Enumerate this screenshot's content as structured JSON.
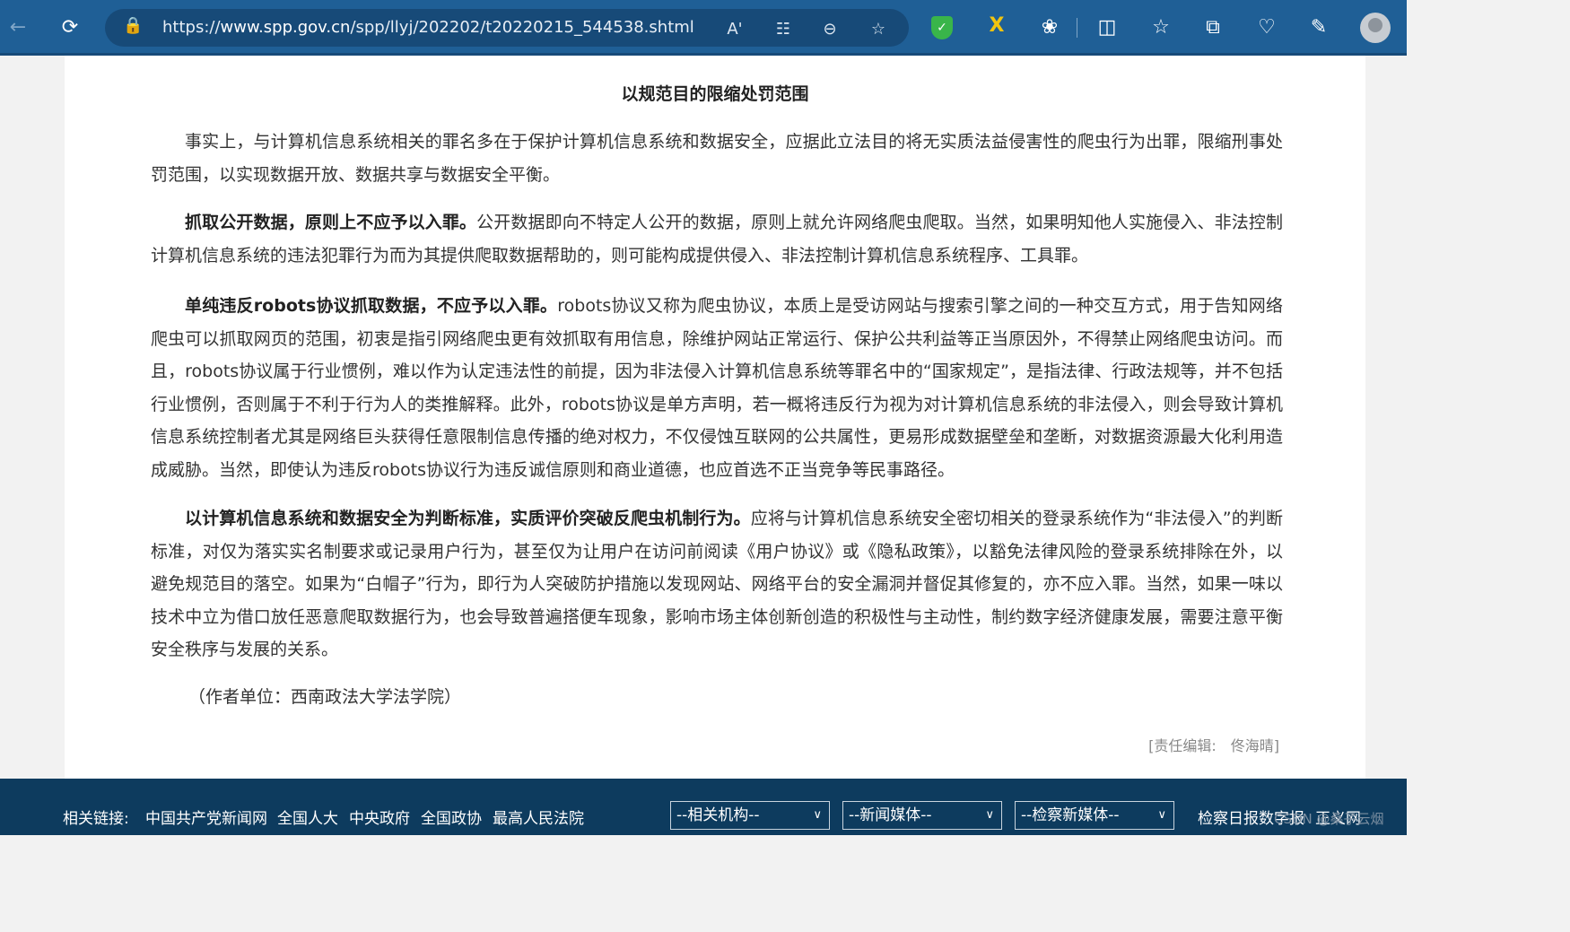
{
  "browser": {
    "url_prefix": "https://",
    "url_domain": "www.spp.gov.cn",
    "url_path": "/spp/llyj/202202/t20220215_544538.shtml"
  },
  "article": {
    "title": "以规范目的限缩处罚范围",
    "p1": "事实上，与计算机信息系统相关的罪名多在于保护计算机信息系统和数据安全，应据此立法目的将无实质法益侵害性的爬虫行为出罪，限缩刑事处罚范围，以实现数据开放、数据共享与数据安全平衡。",
    "p2_bold": "抓取公开数据，原则上不应予以入罪。",
    "p2_text": "公开数据即向不特定人公开的数据，原则上就允许网络爬虫爬取。当然，如果明知他人实施侵入、非法控制计算机信息系统的违法犯罪行为而为其提供爬取数据帮助的，则可能构成提供侵入、非法控制计算机信息系统程序、工具罪。",
    "p3_bold": "单纯违反robots协议抓取数据，不应予以入罪。",
    "p3_text": "robots协议又称为爬虫协议，本质上是受访网站与搜索引擎之间的一种交互方式，用于告知网络爬虫可以抓取网页的范围，初衷是指引网络爬虫更有效抓取有用信息，除维护网站正常运行、保护公共利益等正当原因外，不得禁止网络爬虫访问。而且，robots协议属于行业惯例，难以作为认定违法性的前提，因为非法侵入计算机信息系统等罪名中的“国家规定”，是指法律、行政法规等，并不包括行业惯例，否则属于不利于行为人的类推解释。此外，robots协议是单方声明，若一概将违反行为视为对计算机信息系统的非法侵入，则会导致计算机信息系统控制者尤其是网络巨头获得任意限制信息传播的绝对权力，不仅侵蚀互联网的公共属性，更易形成数据壁垒和垄断，对数据资源最大化利用造成威胁。当然，即使认为违反robots协议行为违反诚信原则和商业道德，也应首选不正当竞争等民事路径。",
    "p4_bold": "以计算机信息系统和数据安全为判断标准，实质评价突破反爬虫机制行为。",
    "p4_text": "应将与计算机信息系统安全密切相关的登录系统作为“非法侵入”的判断标准，对仅为落实实名制要求或记录用户行为，甚至仅为让用户在访问前阅读《用户协议》或《隐私政策》，以豁免法律风险的登录系统排除在外，以避免规范目的落空。如果为“白帽子”行为，即行为人突破防护措施以发现网站、网络平台的安全漏洞并督促其修复的，亦不应入罪。当然，如果一味以技术中立为借口放任恶意爬取数据行为，也会导致普遍搭便车现象，影响市场主体创新创造的积极性与主动性，制约数字经济健康发展，需要注意平衡安全秩序与发展的关系。",
    "author": "（作者单位：西南政法大学法学院）",
    "editor": "[责任编辑:　佟海晴]"
  },
  "footer": {
    "label": "相关链接:",
    "links": [
      "中国共产党新闻网",
      "全国人大",
      "中央政府",
      "全国政协",
      "最高人民法院"
    ],
    "selects": [
      "--相关机构--",
      "--新闻媒体--",
      "--检察新媒体--"
    ],
    "right_links": [
      "检察日报数字报",
      "正义网"
    ],
    "watermark": "CSDN @桑子云烟"
  },
  "colors": {
    "toolbar": "#1f5f96",
    "footer": "#0d3b5e",
    "text": "#333333"
  }
}
